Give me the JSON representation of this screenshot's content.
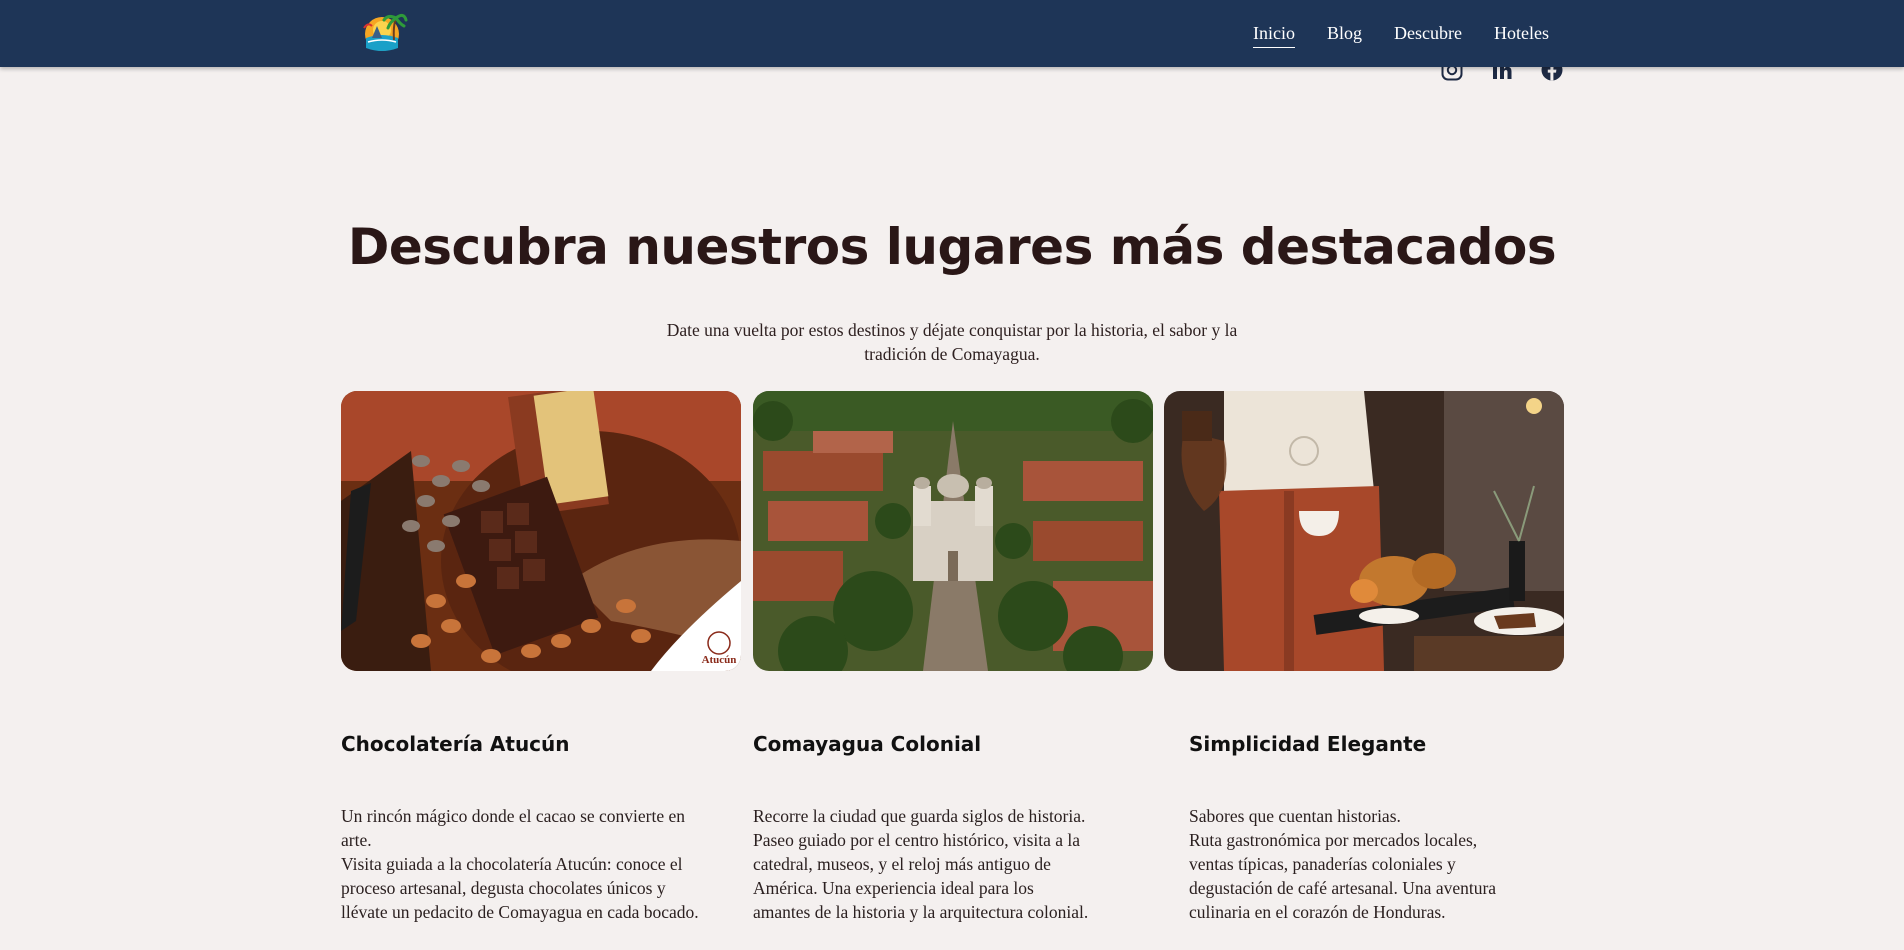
{
  "nav": {
    "items": [
      {
        "label": "Inicio",
        "active": true
      },
      {
        "label": "Blog",
        "active": false
      },
      {
        "label": "Descubre",
        "active": false
      },
      {
        "label": "Hoteles",
        "active": false
      }
    ]
  },
  "social": [
    "instagram-icon",
    "linkedin-icon",
    "facebook-icon"
  ],
  "colors": {
    "header": "#1e3557",
    "background": "#f4f0ef",
    "heading": "#2a1717"
  },
  "main": {
    "title": "Descubra nuestros lugares más destacados",
    "subtitle_line1": "Date una vuelta por estos destinos y déjate conquistar por la historia, el sabor y la",
    "subtitle_line2": "tradición de Comayagua."
  },
  "cards": [
    {
      "title": "Chocolatería Atucún",
      "image_text": "Atucún",
      "lines": [
        "Un rincón mágico donde el cacao se convierte en",
        "arte.",
        "Visita guiada a la chocolatería Atucún: conoce el",
        "proceso artesanal, degusta chocolates únicos y",
        "llévate un pedacito de Comayagua en cada bocado."
      ]
    },
    {
      "title": "Comayagua Colonial",
      "lines": [
        "Recorre la ciudad que guarda siglos de historia.",
        "Paseo guiado por el centro histórico, visita a la",
        "catedral, museos, y el reloj más antiguo de",
        "América. Una experiencia ideal para los",
        "amantes de la historia y la arquitectura colonial."
      ]
    },
    {
      "title": "Simplicidad Elegante",
      "lines": [
        "Sabores que cuentan historias.",
        "Ruta gastronómica por mercados locales,",
        "ventas típicas, panaderías coloniales y",
        "degustación de café artesanal. Una aventura",
        "culinaria en el corazón de Honduras."
      ]
    }
  ]
}
